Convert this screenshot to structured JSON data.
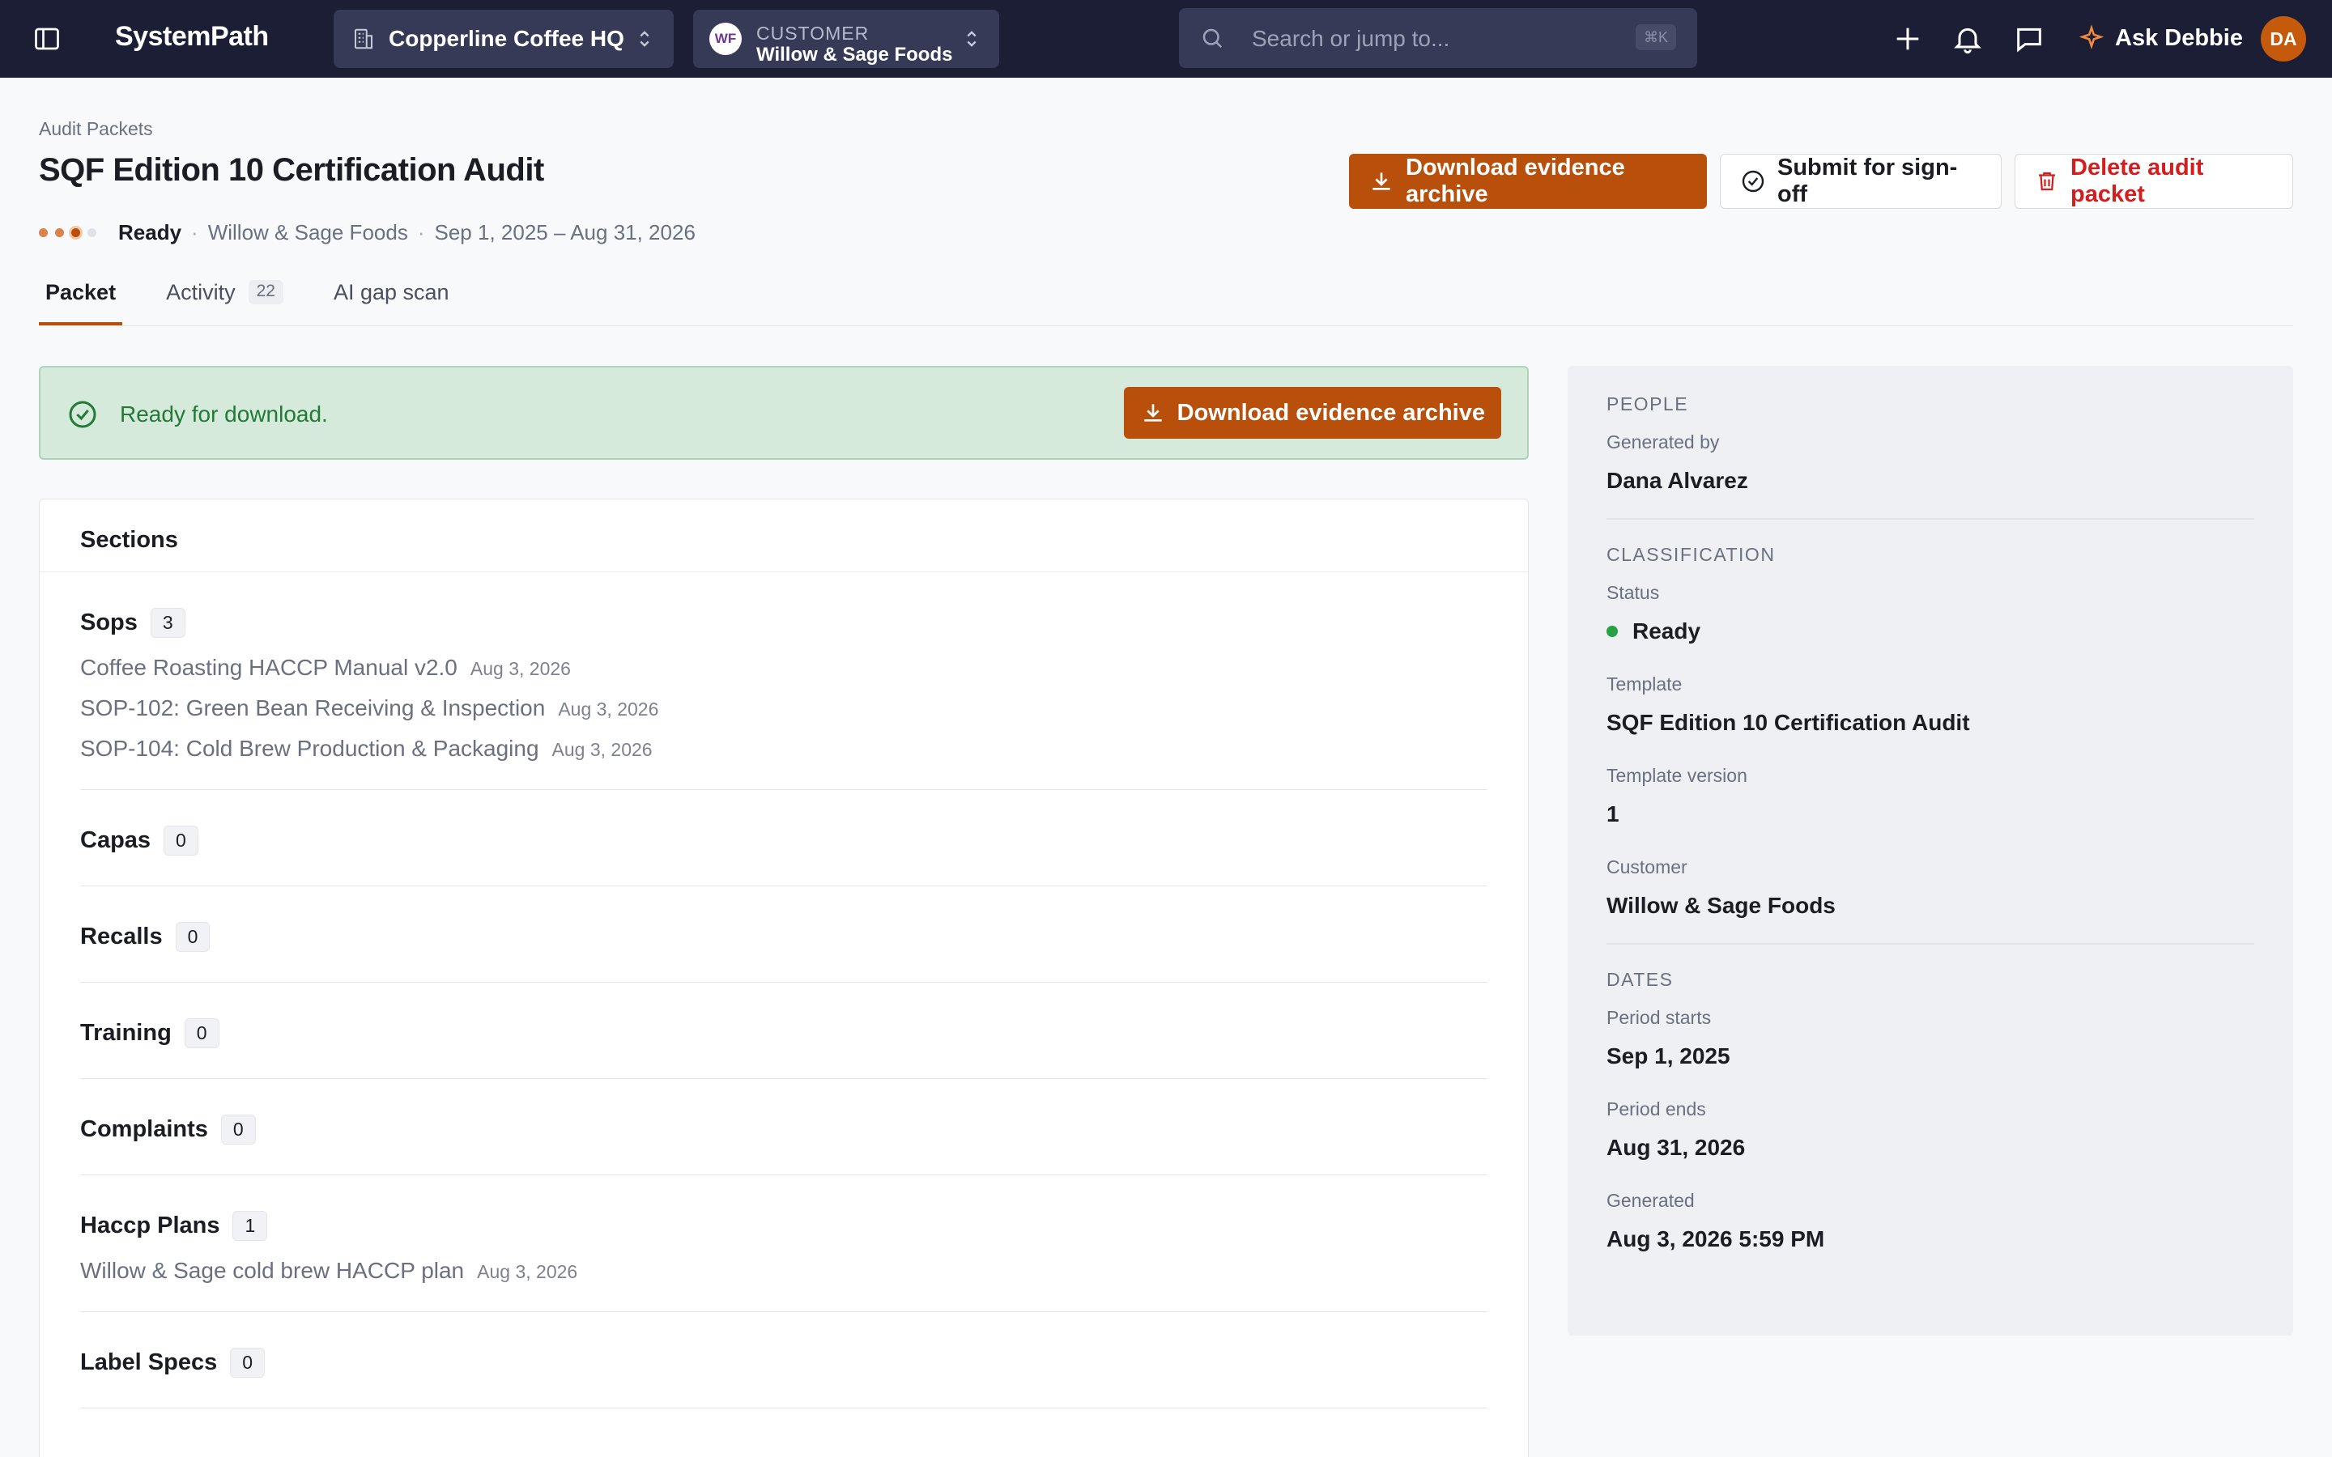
{
  "topbar": {
    "app_name": "SystemPath",
    "org": "Copperline Coffee HQ",
    "customer_label": "CUSTOMER",
    "customer_initials": "WF",
    "customer_name": "Willow & Sage Foods",
    "search_placeholder": "Search or jump to...",
    "search_shortcut": "⌘K",
    "ask_label": "Ask Debbie",
    "user_initials": "DA"
  },
  "header": {
    "breadcrumb": "Audit Packets",
    "title": "SQF Edition 10 Certification Audit",
    "status": "Ready",
    "customer": "Willow & Sage Foods",
    "period": "Sep 1, 2025 – Aug 31, 2026",
    "download_label": "Download evidence archive",
    "submit_label": "Submit for sign-off",
    "delete_label": "Delete audit packet"
  },
  "tabs": [
    {
      "label": "Packet",
      "active": true
    },
    {
      "label": "Activity",
      "count": "22"
    },
    {
      "label": "AI gap scan"
    }
  ],
  "banner": {
    "message": "Ready for download.",
    "download_label": "Download evidence archive"
  },
  "sections": {
    "heading": "Sections",
    "list": [
      {
        "title": "Sops",
        "count": "3",
        "items": [
          {
            "name": "Coffee Roasting HACCP Manual v2.0",
            "date": "Aug 3, 2026"
          },
          {
            "name": "SOP-102: Green Bean Receiving & Inspection",
            "date": "Aug 3, 2026"
          },
          {
            "name": "SOP-104: Cold Brew Production & Packaging",
            "date": "Aug 3, 2026"
          }
        ]
      },
      {
        "title": "Capas",
        "count": "0",
        "items": []
      },
      {
        "title": "Recalls",
        "count": "0",
        "items": []
      },
      {
        "title": "Training",
        "count": "0",
        "items": []
      },
      {
        "title": "Complaints",
        "count": "0",
        "items": []
      },
      {
        "title": "Haccp Plans",
        "count": "1",
        "items": [
          {
            "name": "Willow & Sage cold brew HACCP plan",
            "date": "Aug 3, 2026"
          }
        ]
      },
      {
        "title": "Label Specs",
        "count": "0",
        "items": []
      }
    ]
  },
  "panel": {
    "people": {
      "heading": "PEOPLE",
      "generated_by_label": "Generated by",
      "generated_by": "Dana Alvarez"
    },
    "classification": {
      "heading": "CLASSIFICATION",
      "status_label": "Status",
      "status": "Ready",
      "template_label": "Template",
      "template": "SQF Edition 10 Certification Audit",
      "template_version_label": "Template version",
      "template_version": "1",
      "customer_label": "Customer",
      "customer": "Willow & Sage Foods"
    },
    "dates": {
      "heading": "DATES",
      "period_starts_label": "Period starts",
      "period_starts": "Sep 1, 2025",
      "period_ends_label": "Period ends",
      "period_ends": "Aug 31, 2026",
      "generated_label": "Generated",
      "generated": "Aug 3, 2026 5:59 PM"
    }
  },
  "colors": {
    "topbar_bg": "#1b1e35",
    "accent": "#b8500c",
    "danger": "#d21e1e",
    "success": "#27a144",
    "banner_bg": "#d6eadb"
  },
  "icons": {
    "sidebar_toggle": "sidebar-toggle-icon",
    "org": "building-icon",
    "switch": "chevron-up-down-icon",
    "search": "search-icon",
    "add": "plus-icon",
    "notifications": "bell-icon",
    "messages": "chat-icon",
    "ask": "sparkle-icon",
    "download": "download-icon",
    "submit": "check-circle-icon",
    "delete": "trash-icon"
  }
}
